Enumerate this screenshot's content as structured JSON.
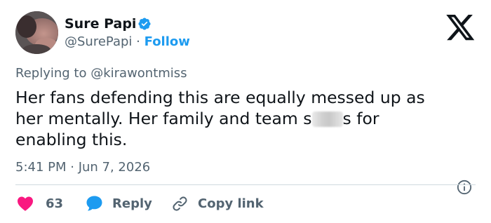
{
  "author": {
    "display_name": "Sure Papi",
    "handle": "@SurePapi",
    "separator": "·",
    "follow_label": "Follow",
    "verified_icon": "verified-badge-icon"
  },
  "reply_context": {
    "prefix": "Replying to",
    "mention": "@kirawontmiss"
  },
  "tweet": {
    "line1": "Her fans defending this are equally messed up as",
    "line2_before": "her mentally. Her family and team s",
    "line2_after": "s for",
    "line3": "enabling this."
  },
  "meta": {
    "timestamp": "5:41 PM · Jun 7, 2026"
  },
  "actions": {
    "like_count": "63",
    "reply_label": "Reply",
    "copy_label": "Copy link"
  },
  "colors": {
    "accent": "#1d9bf0",
    "like": "#f91880",
    "text": "#0f1419",
    "muted": "#536471",
    "divider": "#cfd9de"
  },
  "icons": {
    "brand": "x-logo-icon",
    "info": "info-icon",
    "like": "heart-icon",
    "reply": "speech-bubble-icon",
    "copy": "link-icon"
  }
}
